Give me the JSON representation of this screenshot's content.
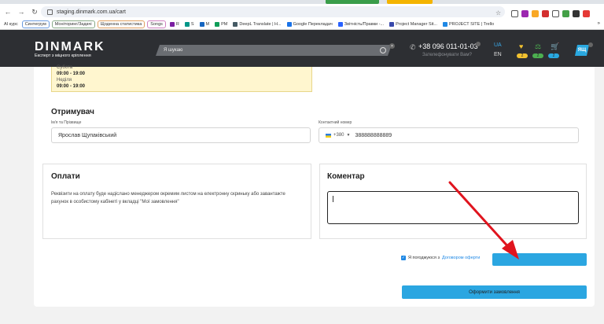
{
  "browser": {
    "url": "staging.dinmark.com.ua/cart",
    "bookmarks": [
      {
        "label": "AI курс",
        "style": "plain"
      },
      {
        "label": "Синтегрум",
        "style": "pill-blue"
      },
      {
        "label": "Моніторинг/Задачі",
        "style": "pill"
      },
      {
        "label": "Щоденна статистика",
        "style": "pill-orange"
      },
      {
        "label": "Songs",
        "style": "pill-pink"
      },
      {
        "label": "R",
        "style": "plain"
      },
      {
        "label": "S",
        "style": "plain"
      },
      {
        "label": "M",
        "style": "plain"
      },
      {
        "label": "PM",
        "style": "plain"
      },
      {
        "label": "DeepL Translate | H...",
        "style": "plain"
      },
      {
        "label": "Google Перекладач",
        "style": "plain"
      },
      {
        "label": "Звітність/Правки -...",
        "style": "plain"
      },
      {
        "label": "Project Manager Sit...",
        "style": "plain"
      },
      {
        "label": "PROJECT SITE | Trello",
        "style": "plain"
      }
    ],
    "bookmarks_more": "»"
  },
  "header": {
    "logo": "DINMARK",
    "tagline": "Експерт з міцного кріплення",
    "search_placeholder": "Я шукаю",
    "phone": "+38 096 011-01-03",
    "callback": "Зателефонувати Вам?",
    "lang_active": "UA",
    "lang_other": "EN",
    "badges": [
      "2",
      "2",
      "2"
    ],
    "account": "ЯЩ",
    "colors": {
      "header_bg": "#2d2f33",
      "accent": "#2ba6e1",
      "badge_yellow": "#f2c230",
      "badge_green": "#4caf50"
    }
  },
  "hours": {
    "lines": [
      "Субота",
      "09:00 - 19:00",
      "Неділя",
      "09:00 - 19:00"
    ]
  },
  "recipient": {
    "title": "Отримувач",
    "name_label": "Ім'я та Прізвище",
    "name_value": "Ярослав Щупаківський",
    "phone_label": "Контактний номер",
    "phone_prefix": "+380",
    "phone_value": "388888888889"
  },
  "payment": {
    "title": "Оплати",
    "text": "Реквізити на оплату буде надіслано менеджером окремим листом на електронну скриньку або завантажте рахунок в особистому кабінеті у вкладці \"Мої замовлення\""
  },
  "comment": {
    "title": "Коментар",
    "value": ""
  },
  "agreement": {
    "text": "Я погоджуюся з",
    "link": "Договором оферти",
    "checked": true
  },
  "actions": {
    "submit_label": "Оформити замовлення"
  }
}
